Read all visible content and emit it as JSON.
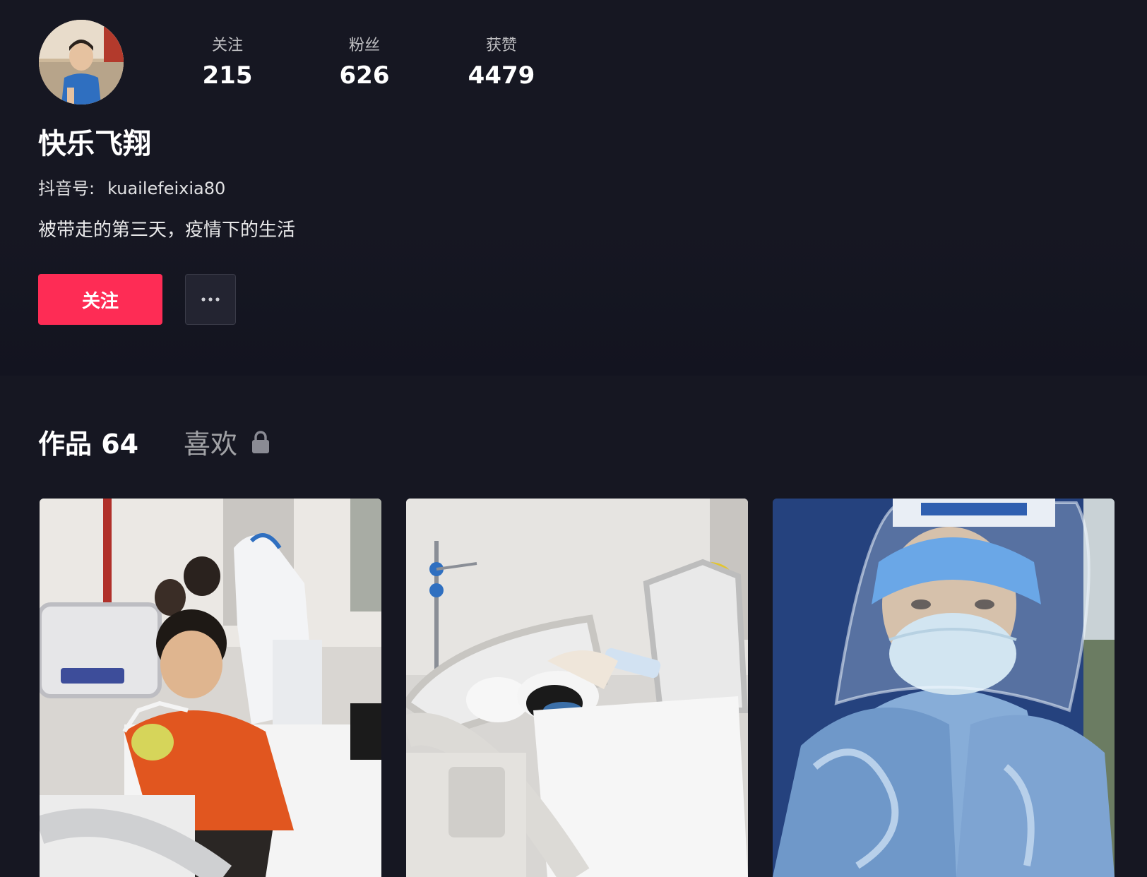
{
  "profile": {
    "nickname": "快乐飞翔",
    "douyin_id_label": "抖音号:",
    "douyin_id": "kuailefeixia80",
    "bio": "被带走的第三天，疫情下的生活",
    "stats": [
      {
        "label": "关注",
        "value": "215"
      },
      {
        "label": "粉丝",
        "value": "626"
      },
      {
        "label": "获赞",
        "value": "4479"
      }
    ]
  },
  "actions": {
    "follow_label": "关注",
    "more_icon": "more-horizontal-icon"
  },
  "tabs": {
    "works_label": "作品 64",
    "likes_label": "喜欢",
    "likes_icon": "lock-icon"
  },
  "colors": {
    "background": "#161722",
    "accent": "#fe2c55"
  }
}
